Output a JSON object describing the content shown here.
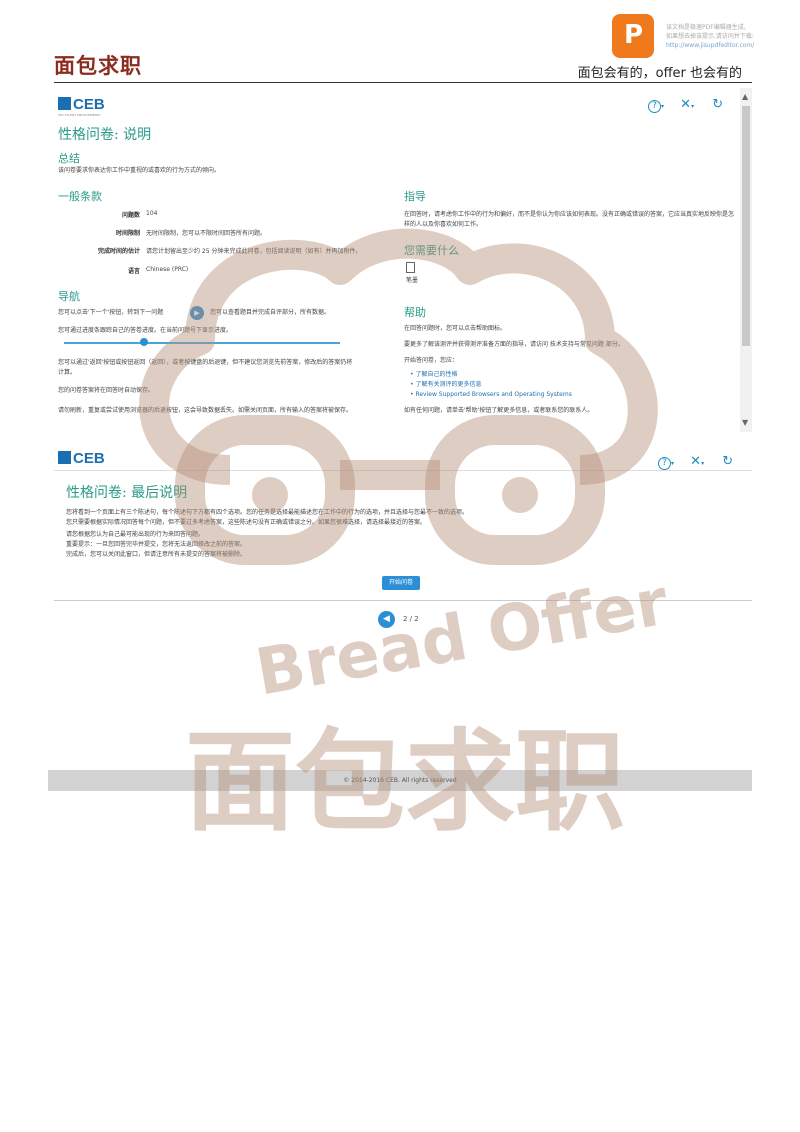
{
  "page_header": {
    "brand": "面包求职",
    "slogan": "面包会有的，offer 也会有的",
    "pdf_note_line1": "该文档是极速PDF编辑器生成,",
    "pdf_note_line2": "如果想去掉该提示,请访问并下载:",
    "pdf_note_url": "http://www.jisupdfeditor.com/"
  },
  "shot1": {
    "logo": "CEB",
    "logo_sub": "SHL TALENT MEASUREMENT",
    "help_icon": "?",
    "page_title": "性格问卷: 说明",
    "summary_heading": "总结",
    "summary_text": "该问卷要求你表达你工作中重视的或喜欢的行为方式的倾向。",
    "general_heading": "一般条款",
    "rows": [
      {
        "label": "问题数",
        "value": "104"
      },
      {
        "label": "时间限制",
        "value": "无时间限制，您可以不限时间回答所有问题。"
      },
      {
        "label": "完成时间的估计",
        "value": "请您计划留出至少约 25 分钟来完成此问卷，包括阅读说明（如有）并再加附件。"
      },
      {
        "label": "语言",
        "value": "Chinese (PRC)"
      }
    ],
    "nav_heading": "导航",
    "nav_text1_a": "您可以点击'下一个'按钮，转到下一问题",
    "nav_text1_b": "您可以查看题目并完成自评部分，所有数据。",
    "nav_text2": "您可通过进度条跟踪自己的答卷进度。在当前问题号下显示进度。",
    "nav_text3": "您可以通过'返回'按钮或按钮返回（返回），或者按键盘的后退键，但不建议您浏览先前答案，修改后的答案仍将计算。",
    "nav_text4": "您的问卷答案将在回答时自动保存。",
    "nav_text5": "请勿刷新，重复或尝试使用浏览器的后退按钮，这会导致数据丢失。如需关闭页面，所有输入的答案将被保存。",
    "guide_heading": "指导",
    "guide_text": "在回答时，请考虑你工作中的行为和偏好，而不是你认为你应该如何表现。没有正确或错误的答案，它应当真实地反映你是怎样的人以及你喜欢如何工作。",
    "need_heading": "您需要什么",
    "need_item": "笔墨",
    "help_heading": "帮助",
    "help_text1": "在回答问题时，您可以点击帮助图标。",
    "help_text2": "要更多了解该测评并获得测评准备方面的指导，请访问 技术支持与常见问题 部分。",
    "help_text3": "开始答问卷，您应：",
    "help_links": [
      "了解自己的性格",
      "了解有关测评的更多信息",
      "Review Supported Browsers and Operating Systems"
    ],
    "help_text4": "如有任何问题，请单击'帮助'按钮了解更多信息，或者联系您的联系人。"
  },
  "shot2": {
    "logo": "CEB",
    "page_title": "性格问卷: 最后说明",
    "lines": [
      "您将看到一个页面上有三个陈述句，每个陈述句下方都有四个选项。您的任务是选择最能描述您在工作中的行为的选项，并且选择与您最不一致的选项。",
      "您只需要根据实际情况回答每个问题，但不要过多考虑答案，这些陈述句没有正确或错误之分。如果您很难选择，请选择最接近的答案。",
      "请您根据您认为自己最可能出现的行为来回答问题。",
      "重要提示：一旦您回答完毕并提交，您将无法返回修改之前的答案。",
      "完成后，您可以关闭此窗口，但请注意所有未提交的答案将被删除。"
    ],
    "start_button": "开始问卷"
  },
  "pager": {
    "prev_label": "◀",
    "page_text": "2 / 2"
  },
  "footer": {
    "copyright": "© 2014-2016 CEB. All rights reserved"
  },
  "watermark": {
    "text_latin": "Bread Offer",
    "text_cn": "面包求职"
  },
  "colors": {
    "accent": "#2c8fd6",
    "heading": "#2a9a8a",
    "brand": "#8b2c1f",
    "watermark": "#b5917b"
  }
}
